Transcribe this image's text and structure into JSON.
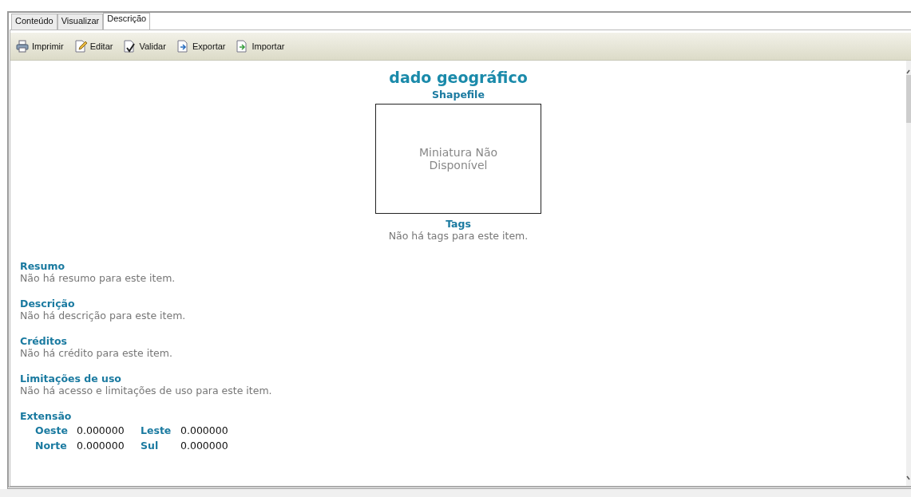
{
  "tabs": [
    {
      "label": "Conteúdo",
      "selected": false
    },
    {
      "label": "Visualizar",
      "selected": false
    },
    {
      "label": "Descrição",
      "selected": true
    }
  ],
  "toolbar": [
    {
      "label": "Imprimir",
      "kind": "print"
    },
    {
      "label": "Editar",
      "kind": "edit"
    },
    {
      "label": "Validar",
      "kind": "validate"
    },
    {
      "label": "Exportar",
      "kind": "export"
    },
    {
      "label": "Importar",
      "kind": "import"
    }
  ],
  "title": "dado geográfico",
  "subtitle": "Shapefile",
  "thumbnail": {
    "text": "Miniatura Não Disponível"
  },
  "tags": {
    "heading": "Tags",
    "text": "Não há tags para este item."
  },
  "sections": [
    {
      "heading": "Resumo",
      "text": "Não há resumo para este item."
    },
    {
      "heading": "Descrição",
      "text": "Não há descrição para este item."
    },
    {
      "heading": "Créditos",
      "text": "Não há crédito para este item."
    },
    {
      "heading": "Limitações de uso",
      "text": "Não há acesso e limitações de uso para este item."
    }
  ],
  "extent": {
    "heading": "Extensão",
    "rows": [
      [
        {
          "label": "Oeste",
          "value": "0.000000"
        },
        {
          "label": "Leste",
          "value": "0.000000"
        }
      ],
      [
        {
          "label": "Norte",
          "value": "0.000000"
        },
        {
          "label": "Sul",
          "value": "0.000000"
        }
      ]
    ]
  }
}
